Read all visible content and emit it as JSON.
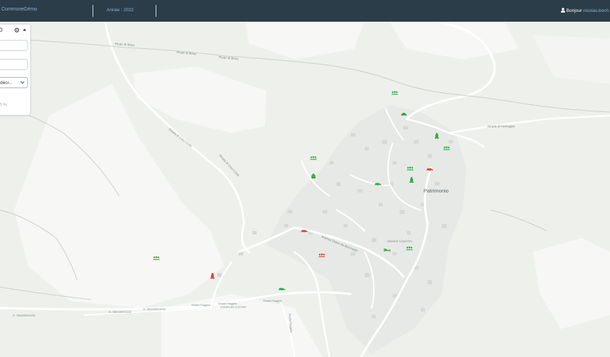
{
  "header": {
    "commune": "CommuneDémo",
    "annee": "Année : 2022",
    "greeting": "Bonjour",
    "user": "nicolas.boch",
    "user_icon": "user-icon"
  },
  "panel": {
    "select_value": "décr...",
    "percent_text": "5 %)"
  },
  "map": {
    "town": "Patrimonio",
    "roads": [
      "Piuan di Bosa",
      "Piuan di Bosa",
      "Piuan di Bosa",
      "Strada di Cioci Cimb",
      "Strada di Cioci Cimb",
      "Strada di Farinaghe",
      "Avenue Diane de Becchelet",
      "A. Vaccarecccia",
      "A. Vaccarecccia",
      "A. Vaccarecccia",
      "Strada Piagghia",
      "Strada Piagghia",
      "Strada Piagghia",
      "Strada Piagghia"
    ],
    "places": [
      "MIRANDE DI MATTEO",
      "CHEMIN DE CUSTORY"
    ],
    "colors": {
      "ok": "#2ea84a",
      "alert": "#e23b3b"
    },
    "markers": [
      {
        "icon": "group-icon",
        "status": "ok"
      },
      {
        "icon": "building-icon",
        "status": "ok"
      },
      {
        "icon": "statue-icon",
        "status": "ok"
      },
      {
        "icon": "group-icon",
        "status": "ok"
      },
      {
        "icon": "group-icon",
        "status": "ok"
      },
      {
        "icon": "statue-icon",
        "status": "ok"
      },
      {
        "icon": "car-icon",
        "status": "alert"
      },
      {
        "icon": "school-icon",
        "status": "ok"
      },
      {
        "icon": "car-icon",
        "status": "ok"
      },
      {
        "icon": "statue-icon",
        "status": "ok"
      },
      {
        "icon": "car-icon",
        "status": "alert"
      },
      {
        "icon": "bed-icon",
        "status": "ok"
      },
      {
        "icon": "group-icon",
        "status": "ok"
      },
      {
        "icon": "group-icon",
        "status": "alert"
      },
      {
        "icon": "group-icon",
        "status": "ok"
      },
      {
        "icon": "statue-icon",
        "status": "alert"
      },
      {
        "icon": "car-icon",
        "status": "ok"
      }
    ]
  }
}
